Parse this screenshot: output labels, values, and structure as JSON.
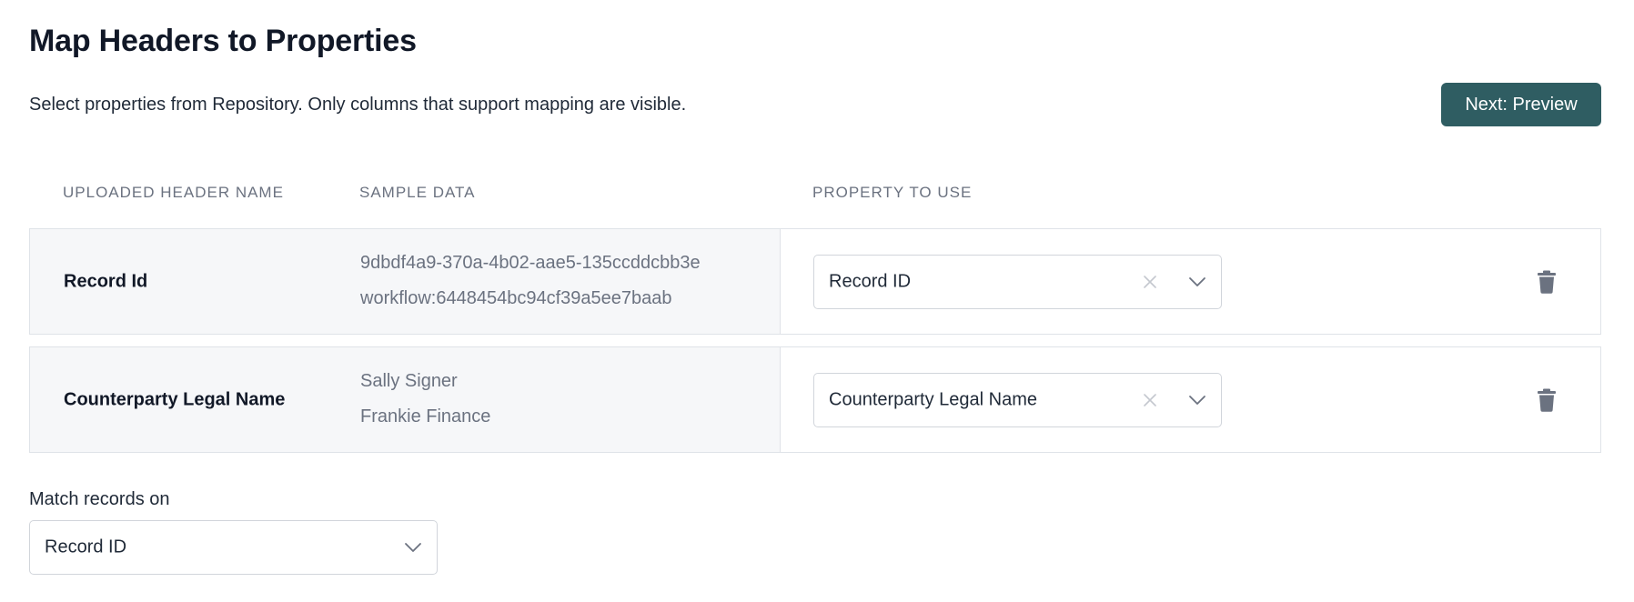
{
  "page": {
    "title": "Map Headers to Properties",
    "subtitle": "Select properties from Repository. Only columns that support mapping are visible.",
    "next_button": "Next: Preview"
  },
  "table": {
    "columns": [
      "UPLOADED HEADER NAME",
      "SAMPLE DATA",
      "PROPERTY TO USE"
    ],
    "rows": [
      {
        "header_name": "Record Id",
        "sample_data": [
          "9dbdf4a9-370a-4b02-aae5-135ccddcbb3e",
          "workflow:6448454bc94cf39a5ee7baab"
        ],
        "property": "Record ID"
      },
      {
        "header_name": "Counterparty Legal Name",
        "sample_data": [
          "Sally Signer",
          "Frankie Finance"
        ],
        "property": "Counterparty Legal Name"
      }
    ]
  },
  "match": {
    "label": "Match records on",
    "value": "Record ID"
  },
  "icons": {
    "clear": "close-icon",
    "dropdown": "chevron-down-icon",
    "delete": "trash-icon"
  },
  "colors": {
    "primary_button": "#2f5d62",
    "panel_background": "#f6f7f9",
    "border": "#dfe3e8",
    "muted_text": "#6b7280"
  }
}
